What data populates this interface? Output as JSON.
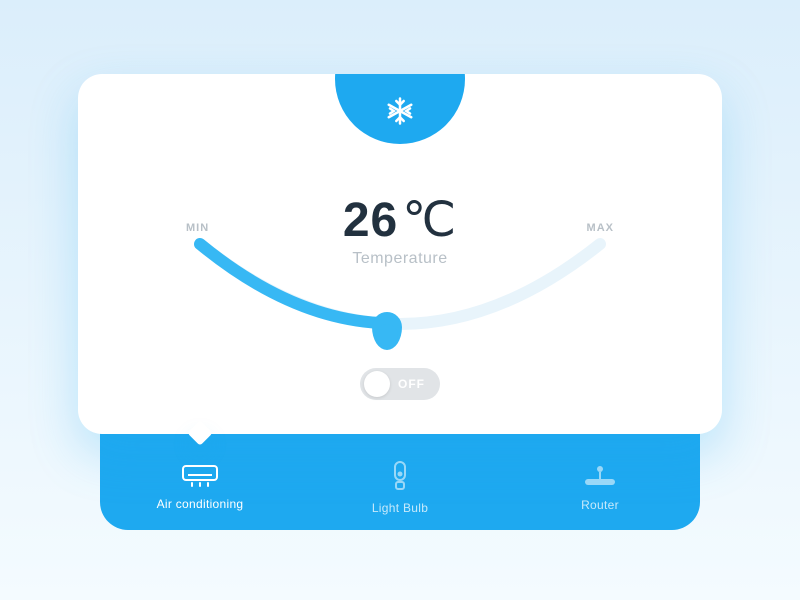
{
  "colors": {
    "accent": "#1ea9f0",
    "text_dark": "#22313f",
    "muted": "#b8c0c7",
    "toggle_bg": "#e1e4e7"
  },
  "temperature": {
    "value": "26",
    "unit": "℃",
    "label": "Temperature",
    "min_label": "MIN",
    "max_label": "MAX"
  },
  "toggle": {
    "state_label": "OFF"
  },
  "tabs": [
    {
      "label": "Air conditioning",
      "icon": "ac-icon",
      "active": true
    },
    {
      "label": "Light Bulb",
      "icon": "bulb-icon",
      "active": false
    },
    {
      "label": "Router",
      "icon": "router-icon",
      "active": false
    }
  ]
}
